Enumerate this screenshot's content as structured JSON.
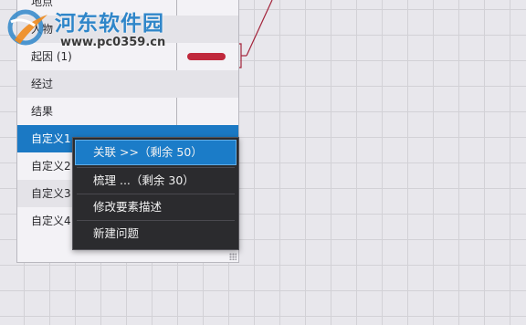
{
  "fields": {
    "items": [
      {
        "label": "地点"
      },
      {
        "label": "人物"
      },
      {
        "label": "起因 (1)"
      },
      {
        "label": "经过"
      },
      {
        "label": "结果"
      },
      {
        "label": "自定义1"
      },
      {
        "label": "自定义2"
      },
      {
        "label": "自定义3"
      },
      {
        "label": "自定义4"
      }
    ],
    "selected_index": 5
  },
  "context_menu": {
    "items": [
      {
        "label": "关联 >>（剩余 50）"
      },
      {
        "label": "梳理 ...（剩余 30）"
      },
      {
        "label": "修改要素描述"
      },
      {
        "label": "新建问题"
      }
    ]
  },
  "watermark": {
    "site_name": "河东软件园",
    "url": "www.pc0359.cn"
  },
  "colors": {
    "selection": "#1b79c4",
    "menu_background": "#2b2b2e",
    "marker": "#c0283c",
    "connector": "#a3233a",
    "watermark": "#2f86c9"
  }
}
